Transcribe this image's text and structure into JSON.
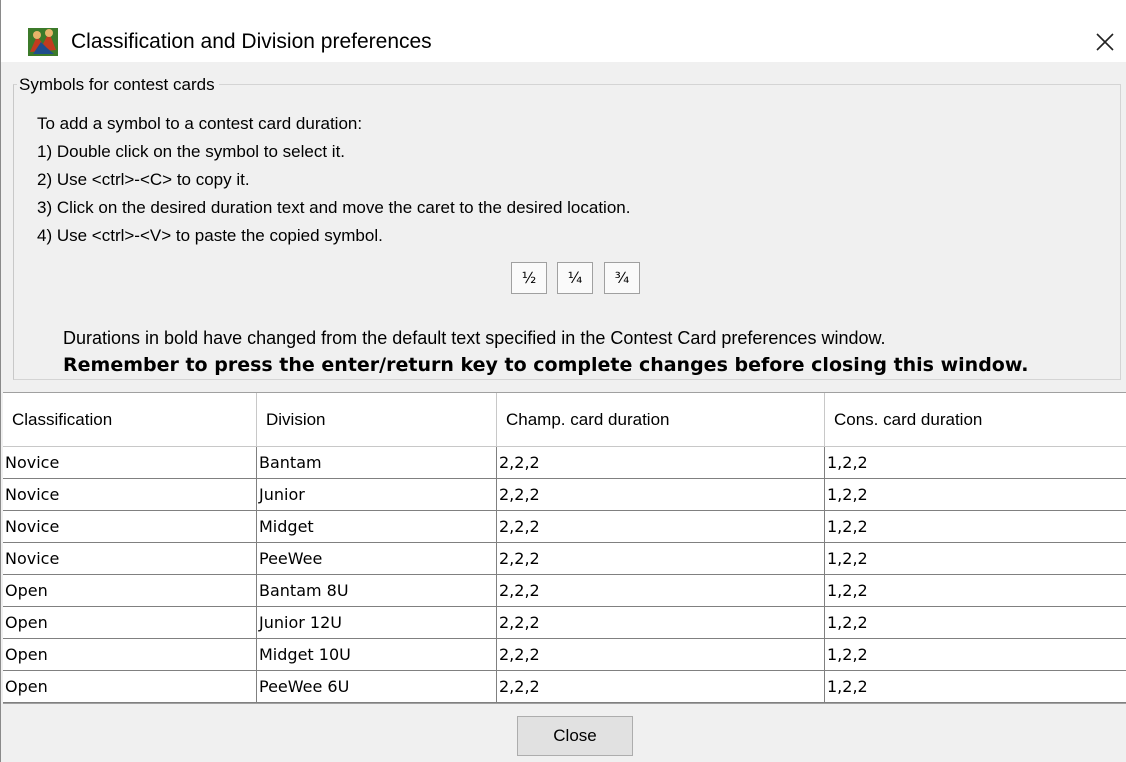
{
  "window": {
    "title": "Classification and Division preferences",
    "app_icon": "wrestling-app-icon",
    "close_icon": "close-icon"
  },
  "symbols_panel": {
    "title": "Symbols for contest cards",
    "instructions": [
      "To add a symbol to a contest card duration:",
      "1) Double click on the symbol to select it.",
      "2) Use <ctrl>-<C> to copy it.",
      "3) Click on the desired duration text and move the caret to the desired location.",
      "4) Use <ctrl>-<V> to paste the copied symbol."
    ],
    "symbols": [
      "½",
      "¼",
      "¾"
    ],
    "note": "Durations in bold have changed from the default text specified in the Contest Card preferences window.",
    "bold_note": "Remember to press the enter/return key to complete changes before closing this window."
  },
  "table": {
    "headers": [
      "Classification",
      "Division",
      "Champ. card duration",
      "Cons. card duration"
    ],
    "rows": [
      [
        "Novice",
        "Bantam",
        "2,2,2",
        "1,2,2"
      ],
      [
        "Novice",
        "Junior",
        "2,2,2",
        "1,2,2"
      ],
      [
        "Novice",
        "Midget",
        "2,2,2",
        "1,2,2"
      ],
      [
        "Novice",
        "PeeWee",
        "2,2,2",
        "1,2,2"
      ],
      [
        "Open",
        "Bantam 8U",
        "2,2,2",
        "1,2,2"
      ],
      [
        "Open",
        "Junior 12U",
        "2,2,2",
        "1,2,2"
      ],
      [
        "Open",
        "Midget 10U",
        "2,2,2",
        "1,2,2"
      ],
      [
        "Open",
        "PeeWee 6U",
        "2,2,2",
        "1,2,2"
      ]
    ]
  },
  "footer": {
    "close_label": "Close"
  }
}
